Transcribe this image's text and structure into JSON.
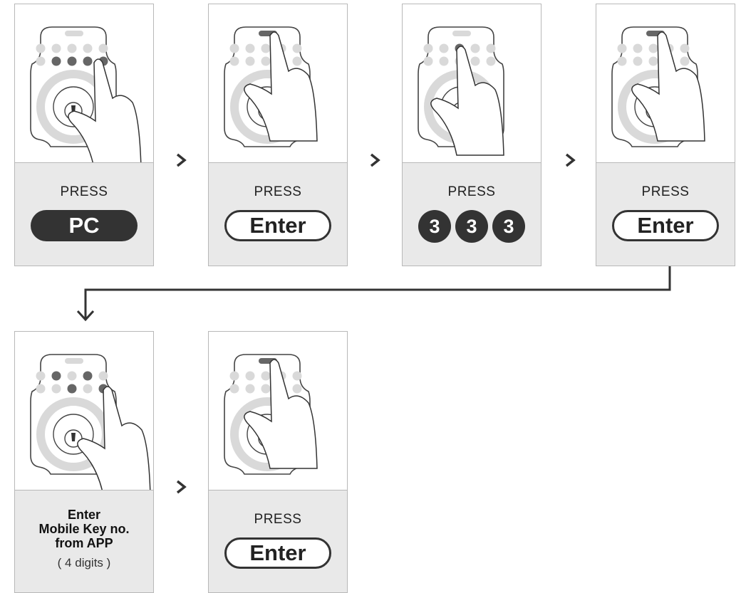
{
  "steps": [
    {
      "id": "s1",
      "press": "PRESS",
      "button": "PC",
      "style": "dark",
      "finger": "pc-key"
    },
    {
      "id": "s2",
      "press": "PRESS",
      "button": "Enter",
      "style": "outline",
      "finger": "enter-key"
    },
    {
      "id": "s3",
      "press": "PRESS",
      "digits": [
        "3",
        "3",
        "3"
      ],
      "finger": "digit-3-key"
    },
    {
      "id": "s4",
      "press": "PRESS",
      "button": "Enter",
      "style": "outline",
      "finger": "enter-key"
    },
    {
      "id": "s5",
      "title_lines": [
        "Enter",
        "Mobile Key no.",
        "from APP"
      ],
      "sub": "( 4 digits )",
      "finger": "mobile-key-digits"
    },
    {
      "id": "s6",
      "press": "PRESS",
      "button": "Enter",
      "style": "outline",
      "finger": "enter-key"
    }
  ],
  "colors": {
    "dark": "#333333",
    "light_gray": "#d9d9d9",
    "mid_gray": "#666666",
    "caption_bg": "#e9e9e9"
  },
  "icons": {
    "next": "chevron-right-icon",
    "flow": "down-arrow-icon"
  }
}
